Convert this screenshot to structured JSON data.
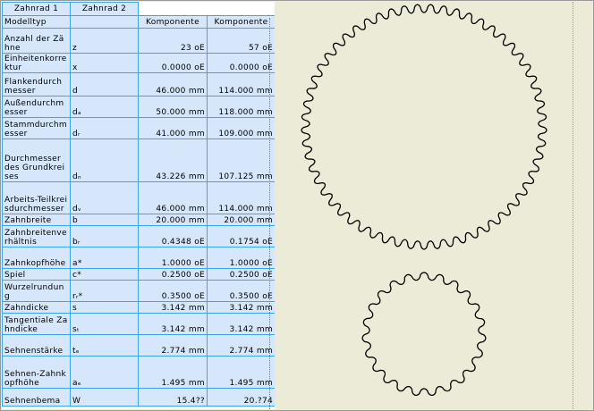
{
  "tabs": [
    "Zahnrad 1",
    "Zahnrad 2"
  ],
  "header": {
    "name": "Modelltyp",
    "comp1": "Komponente",
    "comp2": "Komponente"
  },
  "rows": [
    {
      "name": "Anzahl der Zähne",
      "sym": "z",
      "v1": "23 oE",
      "v2": "57 oE",
      "pink1": true,
      "pink2": true,
      "h": 28
    },
    {
      "name": "Einheitenkorrektur",
      "sym": "x",
      "v1": "0.0000 oE",
      "v2": "0.0000 oE",
      "pink1": true,
      "pink2": false,
      "h": 22
    },
    {
      "name": "Flankendurchmesser",
      "sym": "d",
      "v1": "46.000 mm",
      "v2": "114.000 mm",
      "h": 26
    },
    {
      "name": "Außendurchmesser",
      "sym": "dₐ",
      "v1": "50.000 mm",
      "v2": "118.000 mm",
      "h": 24
    },
    {
      "name": "Stammdurchmesser",
      "sym": "dᵣ",
      "v1": "41.000 mm",
      "v2": "109.000 mm",
      "h": 24
    },
    {
      "name": "Durchmesser des Grundkreises",
      "sym": "dₙ",
      "v1": "43.226 mm",
      "v2": "107.125 mm",
      "h": 48
    },
    {
      "name": "Arbeits-Teilkreisdurchmesser",
      "sym": "dᵥ",
      "v1": "46.000 mm",
      "v2": "114.000 mm",
      "h": 36
    },
    {
      "name": "Zahnbreite",
      "sym": "b",
      "v1": "20.000 mm",
      "v2": "20.000 mm",
      "pink1": true,
      "pink2": true,
      "h": 13
    },
    {
      "name": "Zahnbreitenverhältnis",
      "sym": "bᵣ",
      "v1": "0.4348 oE",
      "v2": "0.1754 oE",
      "h": 24
    },
    {
      "name": "Zahnkopfhöhe",
      "sym": "a*",
      "v1": "1.0000 oE",
      "v2": "1.0000 oE",
      "pink1": true,
      "pink2": false,
      "h": 24
    },
    {
      "name": "Spiel",
      "sym": "c*",
      "v1": "0.2500 oE",
      "v2": "0.2500 oE",
      "pink1": true,
      "pink2": false,
      "h": 13
    },
    {
      "name": "Wurzelrundung",
      "sym": "rᵣ*",
      "v1": "0.3500 oE",
      "v2": "0.3500 oE",
      "pink1": true,
      "pink2": false,
      "h": 24
    },
    {
      "name": "Zahndicke",
      "sym": "s",
      "v1": "3.142 mm",
      "v2": "3.142 mm",
      "h": 13
    },
    {
      "name": "Tangentiale Zahndicke",
      "sym": "sₜ",
      "v1": "3.142 mm",
      "v2": "3.142 mm",
      "h": 24
    },
    {
      "name": "Sehnenstärke",
      "sym": "tₑ",
      "v1": "2.774 mm",
      "v2": "2.774 mm",
      "h": 24
    },
    {
      "name": "Sehnen-Zahnkopfhöhe",
      "sym": "aₑ",
      "v1": "1.495 mm",
      "v2": "1.495 mm",
      "h": 36
    },
    {
      "name": "Sehnenbema",
      "sym": "W",
      "v1": "15.4??",
      "v2": "20.?74",
      "h": 20
    }
  ]
}
